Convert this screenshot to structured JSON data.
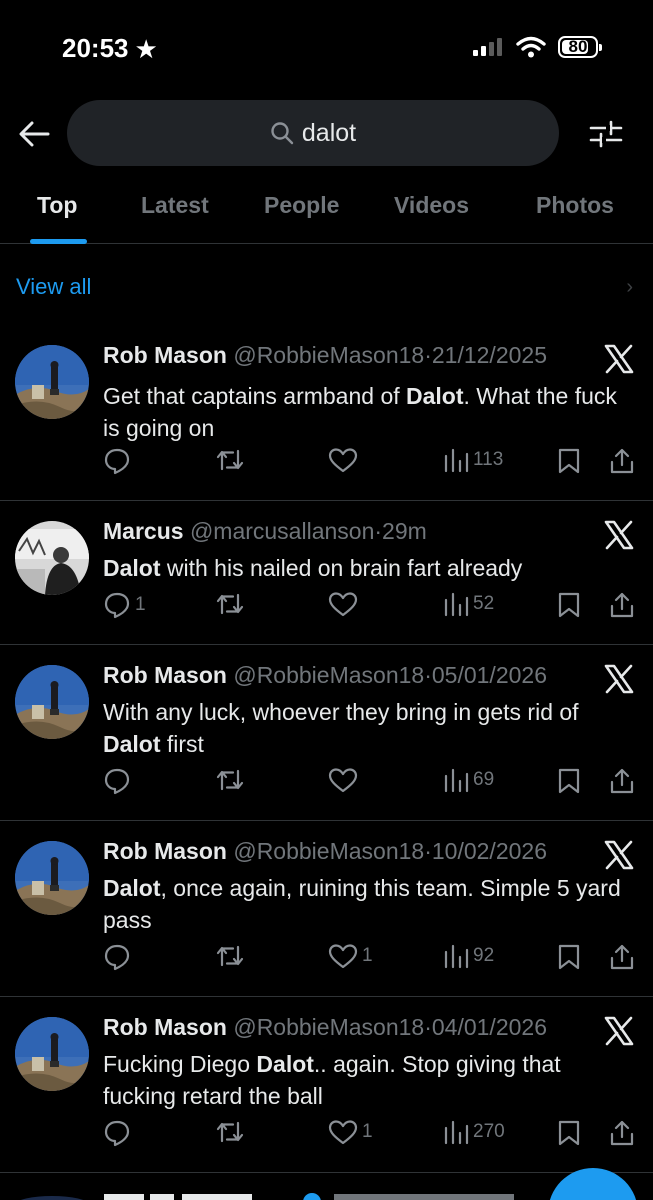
{
  "status": {
    "time": "20:53",
    "battery": "80",
    "battery_level": 0.8
  },
  "search": {
    "query": "dalot"
  },
  "tabs": [
    {
      "label": "Top",
      "active": true
    },
    {
      "label": "Latest",
      "active": false
    },
    {
      "label": "People",
      "active": false
    },
    {
      "label": "Videos",
      "active": false
    },
    {
      "label": "Photos",
      "active": false
    }
  ],
  "view_all": "View all",
  "tweets": [
    {
      "name": "Rob Mason",
      "handle": "@RobbieMason18",
      "sep": "·",
      "date": "21/12/2025",
      "text_parts": [
        "Get that captains armband of ",
        "Dalot",
        ". What the fuck is going on"
      ],
      "replies": "",
      "reposts": "",
      "likes": "",
      "views": "113",
      "avatar": "avatar-rob"
    },
    {
      "name": "Marcus",
      "handle": "@marcusallanson",
      "sep": "·",
      "date": "29m",
      "text_parts": [
        "",
        "Dalot",
        " with his nailed on brain fart already"
      ],
      "replies": "1",
      "reposts": "",
      "likes": "",
      "views": "52",
      "avatar": "avatar-marcus"
    },
    {
      "name": "Rob Mason",
      "handle": "@RobbieMason18",
      "sep": "·",
      "date": "05/01/2026",
      "text_parts": [
        "With any luck, whoever they bring in gets rid of ",
        "Dalot",
        " first"
      ],
      "replies": "",
      "reposts": "",
      "likes": "",
      "views": "69",
      "avatar": "avatar-rob"
    },
    {
      "name": "Rob Mason",
      "handle": "@RobbieMason18",
      "sep": "·",
      "date": "10/02/2026",
      "text_parts": [
        "",
        "Dalot",
        ", once again, ruining this team. Simple 5 yard pass"
      ],
      "replies": "",
      "reposts": "",
      "likes": "1",
      "views": "92",
      "avatar": "avatar-rob"
    },
    {
      "name": "Rob Mason",
      "handle": "@RobbieMason18",
      "sep": "·",
      "date": "04/01/2026",
      "text_parts": [
        "Fucking Diego ",
        "Dalot",
        ".. again. Stop giving that fucking retard the ball"
      ],
      "replies": "",
      "reposts": "",
      "likes": "1",
      "views": "270",
      "avatar": "avatar-rob"
    }
  ],
  "colors": {
    "background": "#000000",
    "accent": "#1d9bf0",
    "secondary_text": "#71767b",
    "search_bg": "#202327"
  }
}
